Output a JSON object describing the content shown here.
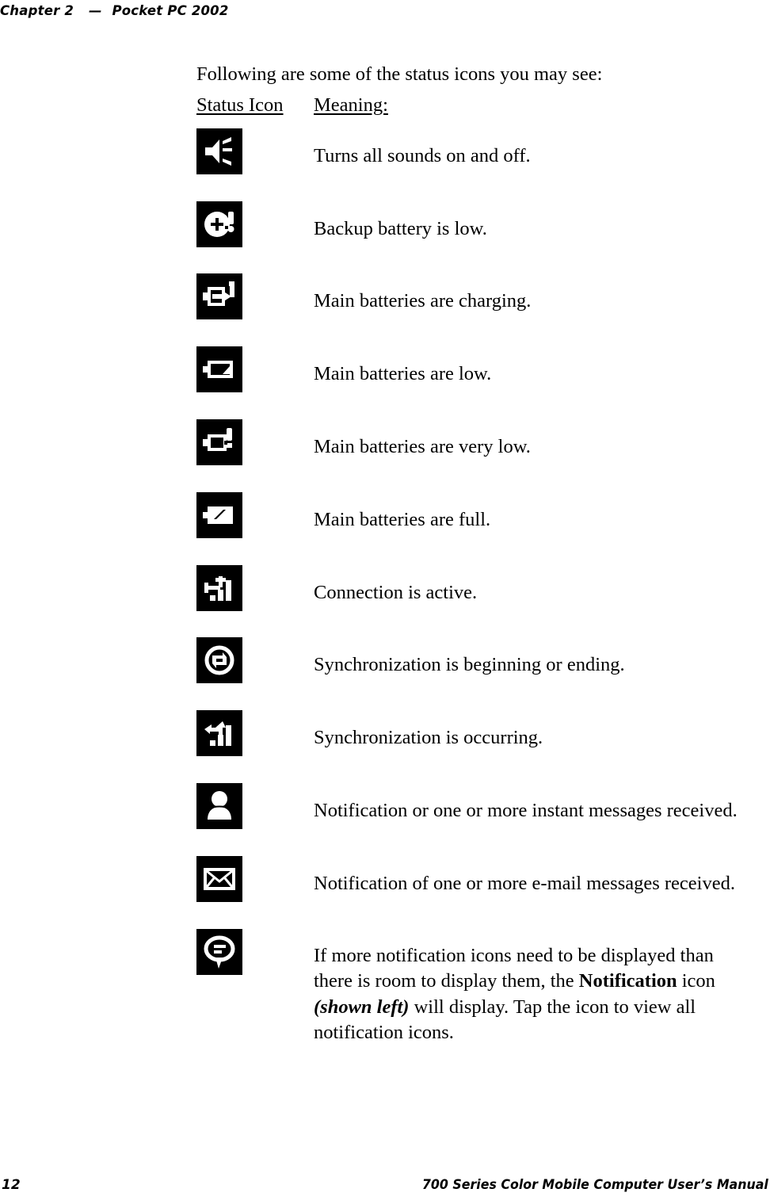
{
  "header": {
    "chapter": "Chapter 2",
    "dash": "—",
    "title": "Pocket PC 2002"
  },
  "intro": "Following are some of the status icons you may see:",
  "columns": {
    "icon": "Status Icon",
    "meaning": "Meaning:"
  },
  "rows": [
    {
      "icon_name": "speaker-sound-icon",
      "meaning": "Turns all sounds on and off."
    },
    {
      "icon_name": "backup-battery-low-icon",
      "meaning": "Backup battery is low."
    },
    {
      "icon_name": "battery-charging-icon",
      "meaning": "Main batteries are charging."
    },
    {
      "icon_name": "battery-low-icon",
      "meaning": "Main batteries are low."
    },
    {
      "icon_name": "battery-very-low-icon",
      "meaning": "Main batteries are very low."
    },
    {
      "icon_name": "battery-full-icon",
      "meaning": "Main batteries are full."
    },
    {
      "icon_name": "connection-active-icon",
      "meaning": "Connection is active."
    },
    {
      "icon_name": "sync-start-end-icon",
      "meaning": "Synchronization is beginning or ending."
    },
    {
      "icon_name": "sync-occurring-icon",
      "meaning": "Synchronization is occurring."
    },
    {
      "icon_name": "instant-message-icon",
      "meaning": "Notification or one or more instant messages received."
    },
    {
      "icon_name": "email-message-icon",
      "meaning": "Notification of one or more e-mail messages received."
    }
  ],
  "notification_row": {
    "icon_name": "notification-balloon-icon",
    "part1": "If more notification icons need to be displayed than there is room to display them, the ",
    "bold": "Notification",
    "part2": " icon ",
    "bold_italic": "(shown left)",
    "part3": " will display. Tap the icon to view all notification icons."
  },
  "footer": {
    "page_number": "12",
    "manual_title": "700 Series Color Mobile Computer User’s Manual"
  },
  "colors": {
    "text": "#000000",
    "icon_background": "#000000",
    "icon_foreground": "#ffffff",
    "page_background": "#ffffff"
  }
}
